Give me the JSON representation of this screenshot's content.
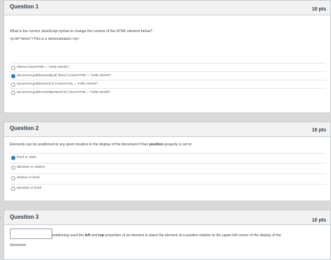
{
  "q1": {
    "title": "Question 1",
    "pts": "10 pts",
    "prompt": "What is the correct JavaScript syntax to change the content of the HTML element below?",
    "code": "<p id=\"demo\">This is a demonstration.</p>",
    "answers": [
      {
        "text": "#demo.innerHTML = \"Hello World!\";",
        "selected": false
      },
      {
        "text": "document.getElementById(\"demo\").innerHTML = \"Hello World!\";",
        "selected": true
      },
      {
        "text": "document.getElement(\"p\").innerHTML = \"Hello World!\";",
        "selected": false
      },
      {
        "text": "document.getElementByName(\"p\").innerHTML = \"Hello World!\";",
        "selected": false
      }
    ]
  },
  "q2": {
    "title": "Question 2",
    "pts": "10 pts",
    "prompt_pre": "Elements can be positioned at any given location in the display of the document if their ",
    "prompt_bold": "position",
    "prompt_post": " property is set to:",
    "answers": [
      {
        "text": "fixed or static",
        "selected": true
      },
      {
        "text": "absolute or relative",
        "selected": false
      },
      {
        "text": "relative or fixed",
        "selected": false
      },
      {
        "text": "absolute or fixed",
        "selected": false
      }
    ]
  },
  "q3": {
    "title": "Question 3",
    "pts": "10 pts",
    "prompt_a": "positioning used the ",
    "bold_left": "left",
    "prompt_and": " and ",
    "bold_top": "top",
    "prompt_b": " properties of an element to place the element at a position relative to the upper-left corner of the display of the",
    "prompt_c": "document",
    "blank_value": ""
  },
  "colors": {
    "selected_radio": "#2b7abc",
    "header_bg": "#f2f2f2"
  }
}
